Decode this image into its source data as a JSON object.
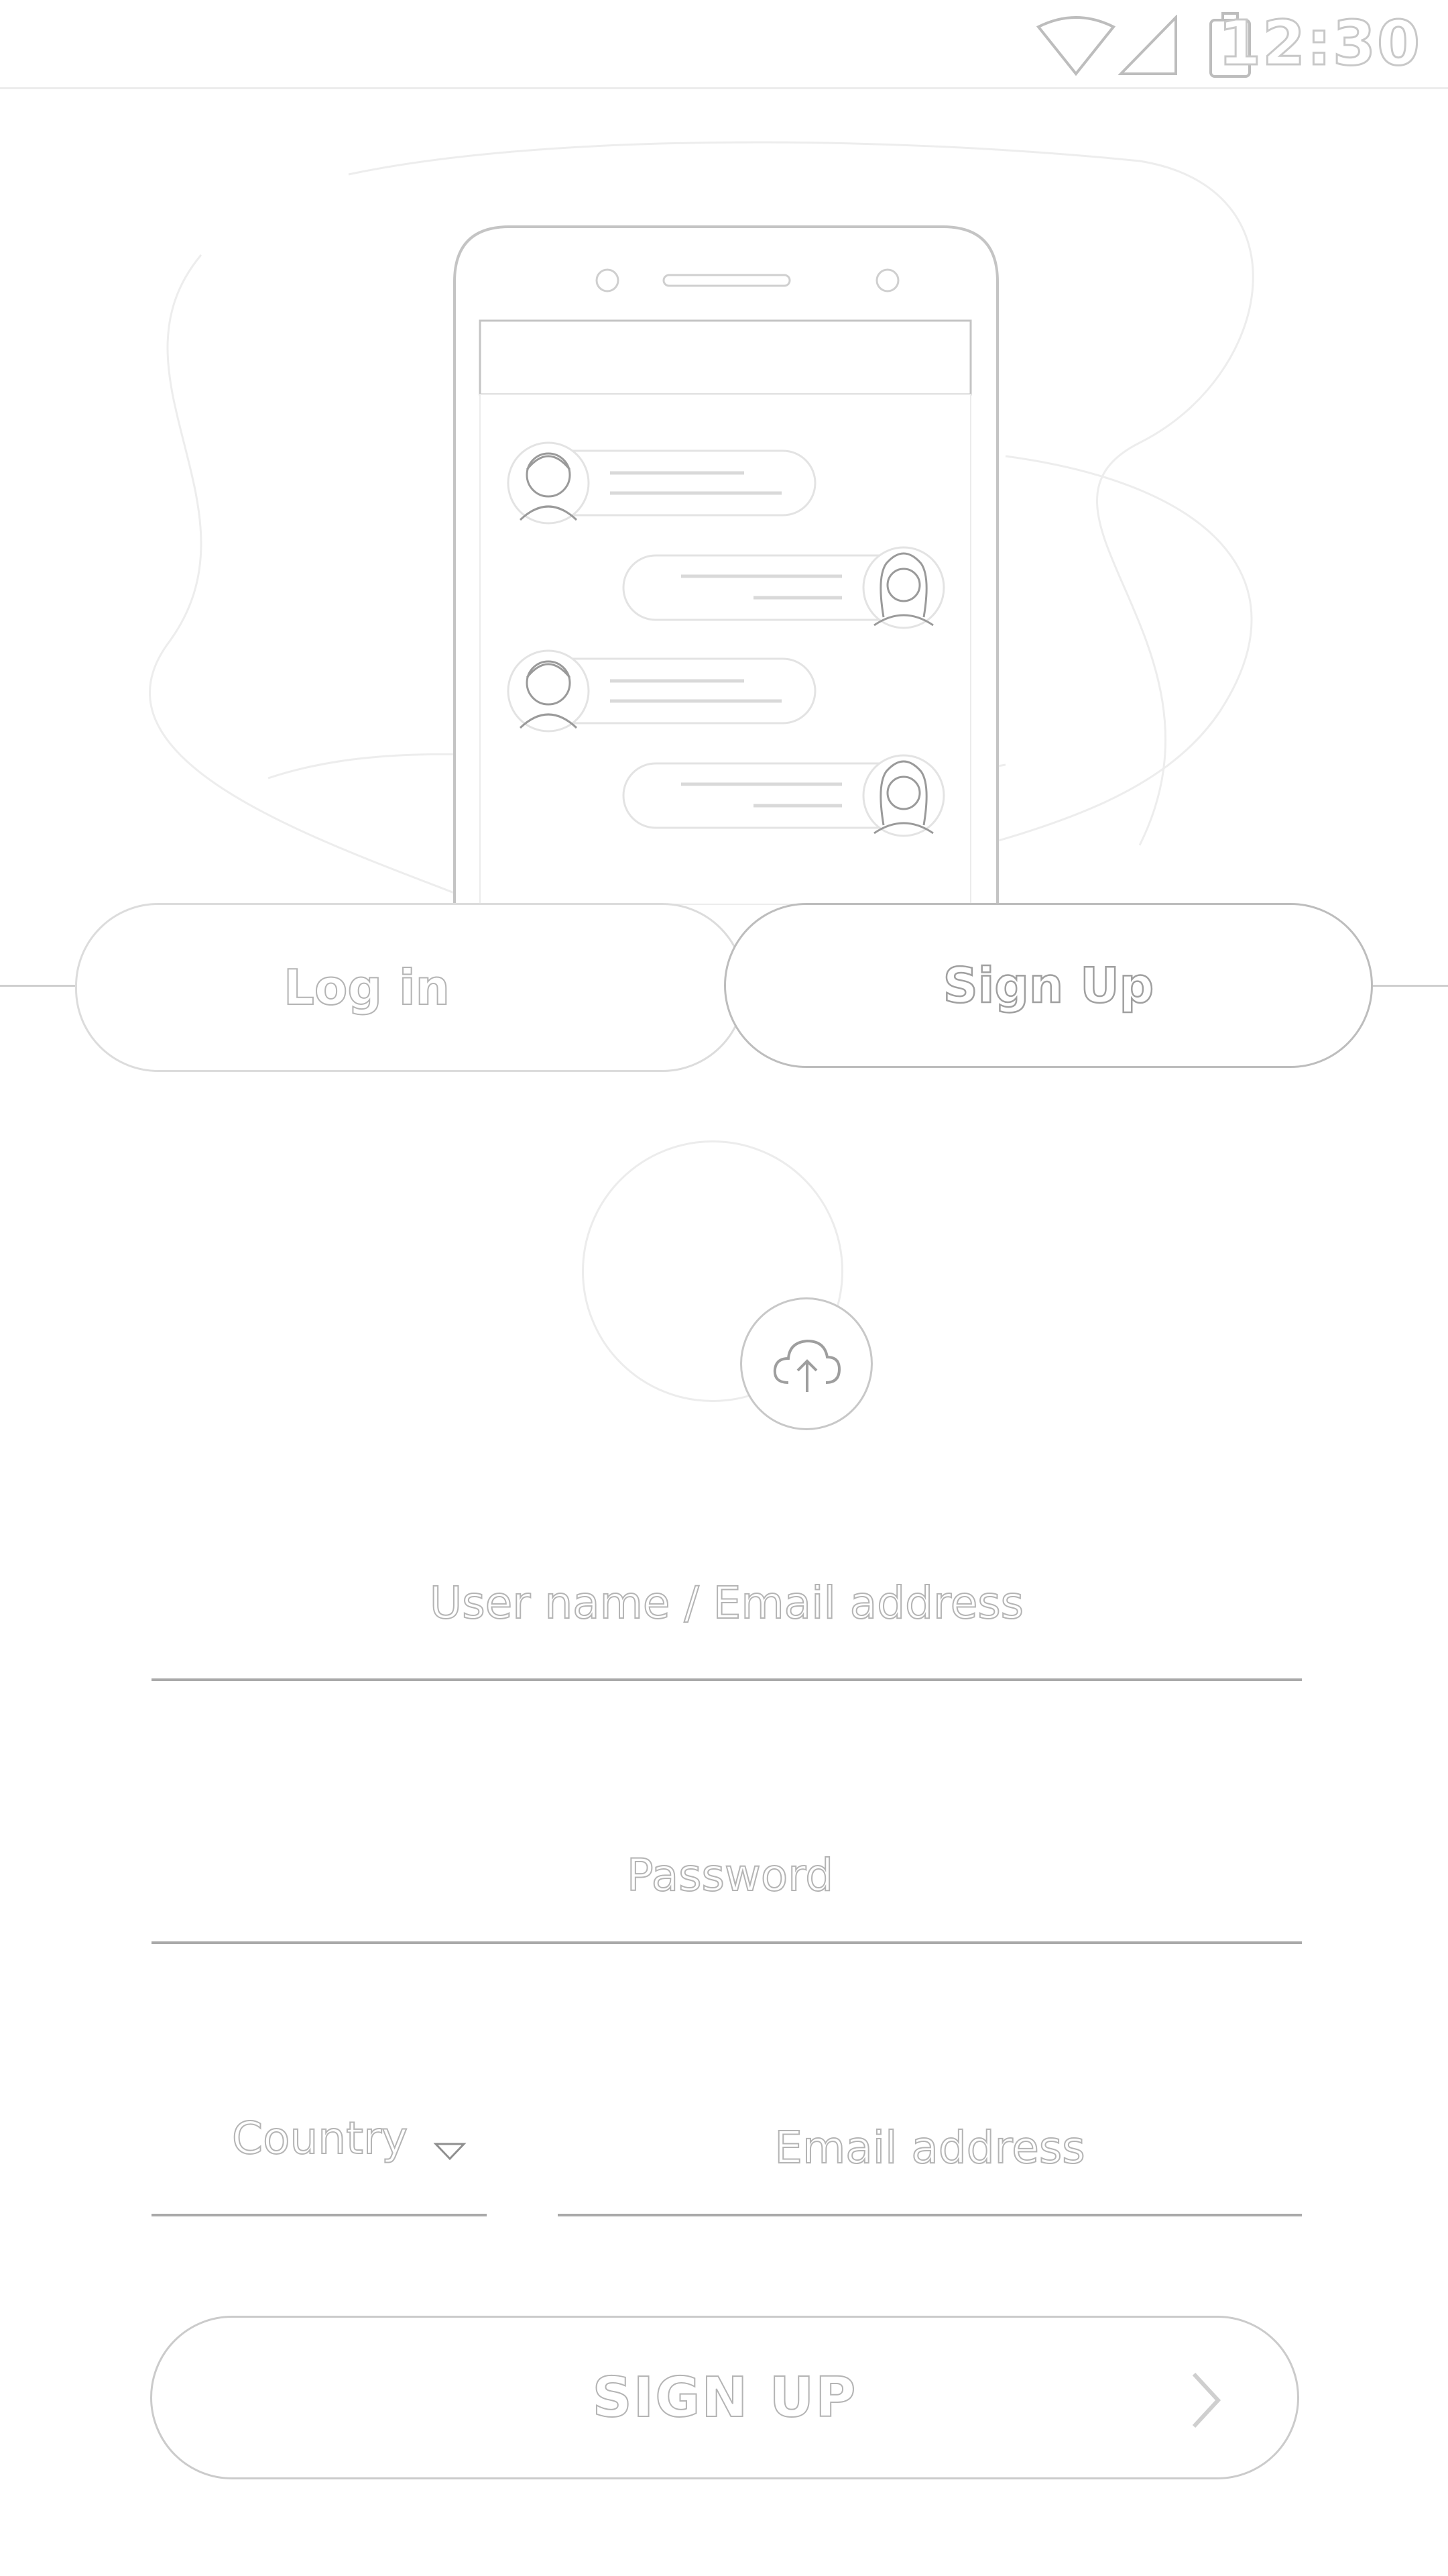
{
  "status_bar": {
    "time": "12:30",
    "icons": [
      "wifi-icon",
      "signal-icon",
      "battery-icon"
    ]
  },
  "illustration": {
    "name": "phone-chat-illustration",
    "avatars": [
      "male-avatar-icon",
      "female-avatar-icon",
      "male-avatar-icon",
      "female-avatar-icon"
    ]
  },
  "tabs": {
    "login_label": "Log in",
    "signup_label": "Sign Up",
    "active": "signup"
  },
  "avatar_upload": {
    "icon": "cloud-upload-icon"
  },
  "form": {
    "username_placeholder": "User name / Email address",
    "password_placeholder": "Password",
    "country_label": "Country",
    "country_icon": "chevron-down-icon",
    "email_placeholder": "Email address",
    "submit_label": "SIGN UP",
    "submit_icon": "chevron-right-icon"
  },
  "colors": {
    "background": "#ffffff",
    "outline": "#b4b4b4",
    "line": "#a9a9a9"
  }
}
